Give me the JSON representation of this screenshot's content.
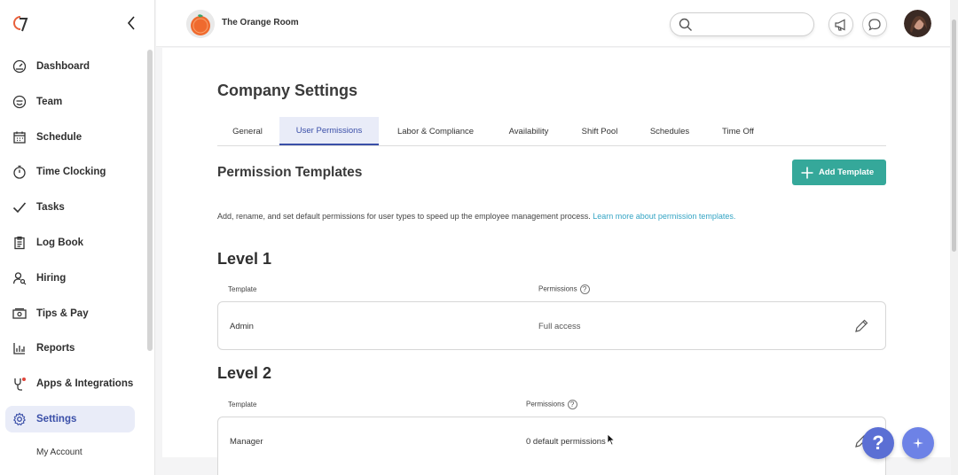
{
  "sidebar": {
    "items": [
      {
        "label": "Dashboard",
        "icon": "dashboard-icon"
      },
      {
        "label": "Team",
        "icon": "smiley-icon"
      },
      {
        "label": "Schedule",
        "icon": "calendar-icon"
      },
      {
        "label": "Time Clocking",
        "icon": "stopwatch-icon"
      },
      {
        "label": "Tasks",
        "icon": "checkmark-icon"
      },
      {
        "label": "Log Book",
        "icon": "clipboard-icon"
      },
      {
        "label": "Hiring",
        "icon": "person-search-icon"
      },
      {
        "label": "Tips & Pay",
        "icon": "money-icon"
      },
      {
        "label": "Reports",
        "icon": "bar-chart-icon"
      },
      {
        "label": "Apps & Integrations",
        "icon": "plug-icon"
      },
      {
        "label": "Settings",
        "icon": "gear-icon",
        "active": true
      }
    ],
    "sub_item": "My Account"
  },
  "topbar": {
    "org_name": "The Orange Room",
    "search_placeholder": ""
  },
  "page": {
    "title": "Company Settings",
    "tabs": [
      {
        "label": "General"
      },
      {
        "label": "User Permissions",
        "active": true
      },
      {
        "label": "Labor & Compliance"
      },
      {
        "label": "Availability"
      },
      {
        "label": "Shift Pool"
      },
      {
        "label": "Schedules"
      },
      {
        "label": "Time Off"
      }
    ],
    "section_title": "Permission Templates",
    "add_button": "Add Template",
    "description": "Add, rename, and set default permissions for user types to speed up the employee management process.",
    "learn_more": "Learn more about permission templates.",
    "levels": [
      {
        "title": "Level 1",
        "col_template": "Template",
        "col_permissions": "Permissions",
        "rows": [
          {
            "template": "Admin",
            "permissions": "Full access"
          }
        ]
      },
      {
        "title": "Level 2",
        "col_template": "Template",
        "col_permissions": "Permissions",
        "rows": [
          {
            "template": "Manager",
            "permissions": "0 default permissions"
          }
        ]
      }
    ]
  },
  "fab": {
    "help_label": "?"
  },
  "colors": {
    "accent": "#3a4fa8",
    "accent_bg": "#e9ecf8",
    "teal": "#35a89a",
    "link": "#34a4c4",
    "fab": "#5b6fd4"
  }
}
